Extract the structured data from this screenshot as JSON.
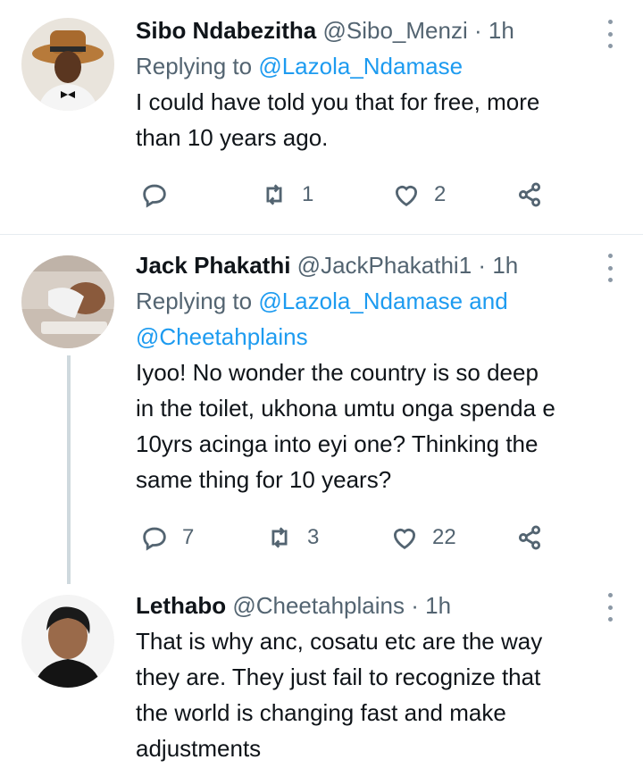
{
  "tweets": [
    {
      "name": "Sibo Ndabezitha",
      "handle": "@Sibo_Menzi",
      "dot": "·",
      "time": "1h",
      "replying_prefix": "Replying to",
      "replying_to": "@Lazola_Ndamase",
      "replying_and": "",
      "replying_to_2": "",
      "text_lines": [
        "I could have told you that for free, more",
        "than 10 years ago."
      ],
      "reply_count": "",
      "retweet_count": "1",
      "like_count": "2"
    },
    {
      "name": "Jack Phakathi",
      "handle": "@JackPhakathi1",
      "dot": "·",
      "time": "1h",
      "replying_prefix": "Replying to",
      "replying_to": "@Lazola_Ndamase",
      "replying_and": "and",
      "replying_to_2": "@Cheetahplains",
      "text_lines": [
        "Iyoo! No wonder the country is so deep",
        "in the toilet, ukhona umtu onga spenda e",
        "10yrs acinga into eyi one? Thinking the",
        "same thing for 10 years?"
      ],
      "reply_count": "7",
      "retweet_count": "3",
      "like_count": "22"
    },
    {
      "name": "Lethabo",
      "handle": "@Cheetahplains",
      "dot": "·",
      "time": "1h",
      "text_lines": [
        "That is why anc, cosatu etc are the way",
        "they are. They just fail to recognize that",
        "the world is changing fast and make",
        "adjustments"
      ]
    }
  ],
  "icons": {
    "reply": "reply-icon",
    "retweet": "retweet-icon",
    "like": "heart-icon",
    "share": "share-icon",
    "more": "more-vertical-icon"
  }
}
